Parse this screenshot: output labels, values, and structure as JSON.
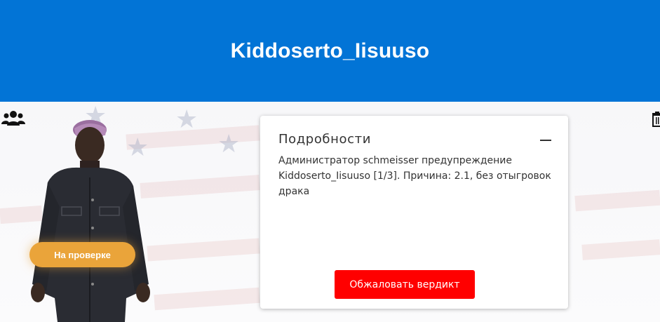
{
  "header": {
    "title": "Kiddoserto_Iisuuso"
  },
  "hero": {
    "status_label": "На проверке"
  },
  "card": {
    "title": "Подробности",
    "text": "Администратор schmeisser предупреждение Kiddoserto_Iisuuso [1/3]. Причина: 2.1, без отыгровок драка",
    "appeal_label": "Обжаловать вердикт"
  },
  "colors": {
    "header_bg": "#0274d6",
    "status_bg": "#eaa43a",
    "appeal_bg": "#ff0000"
  },
  "icons": {
    "users": "users-icon",
    "trash": "trash-icon",
    "collapse": "minus-icon"
  }
}
